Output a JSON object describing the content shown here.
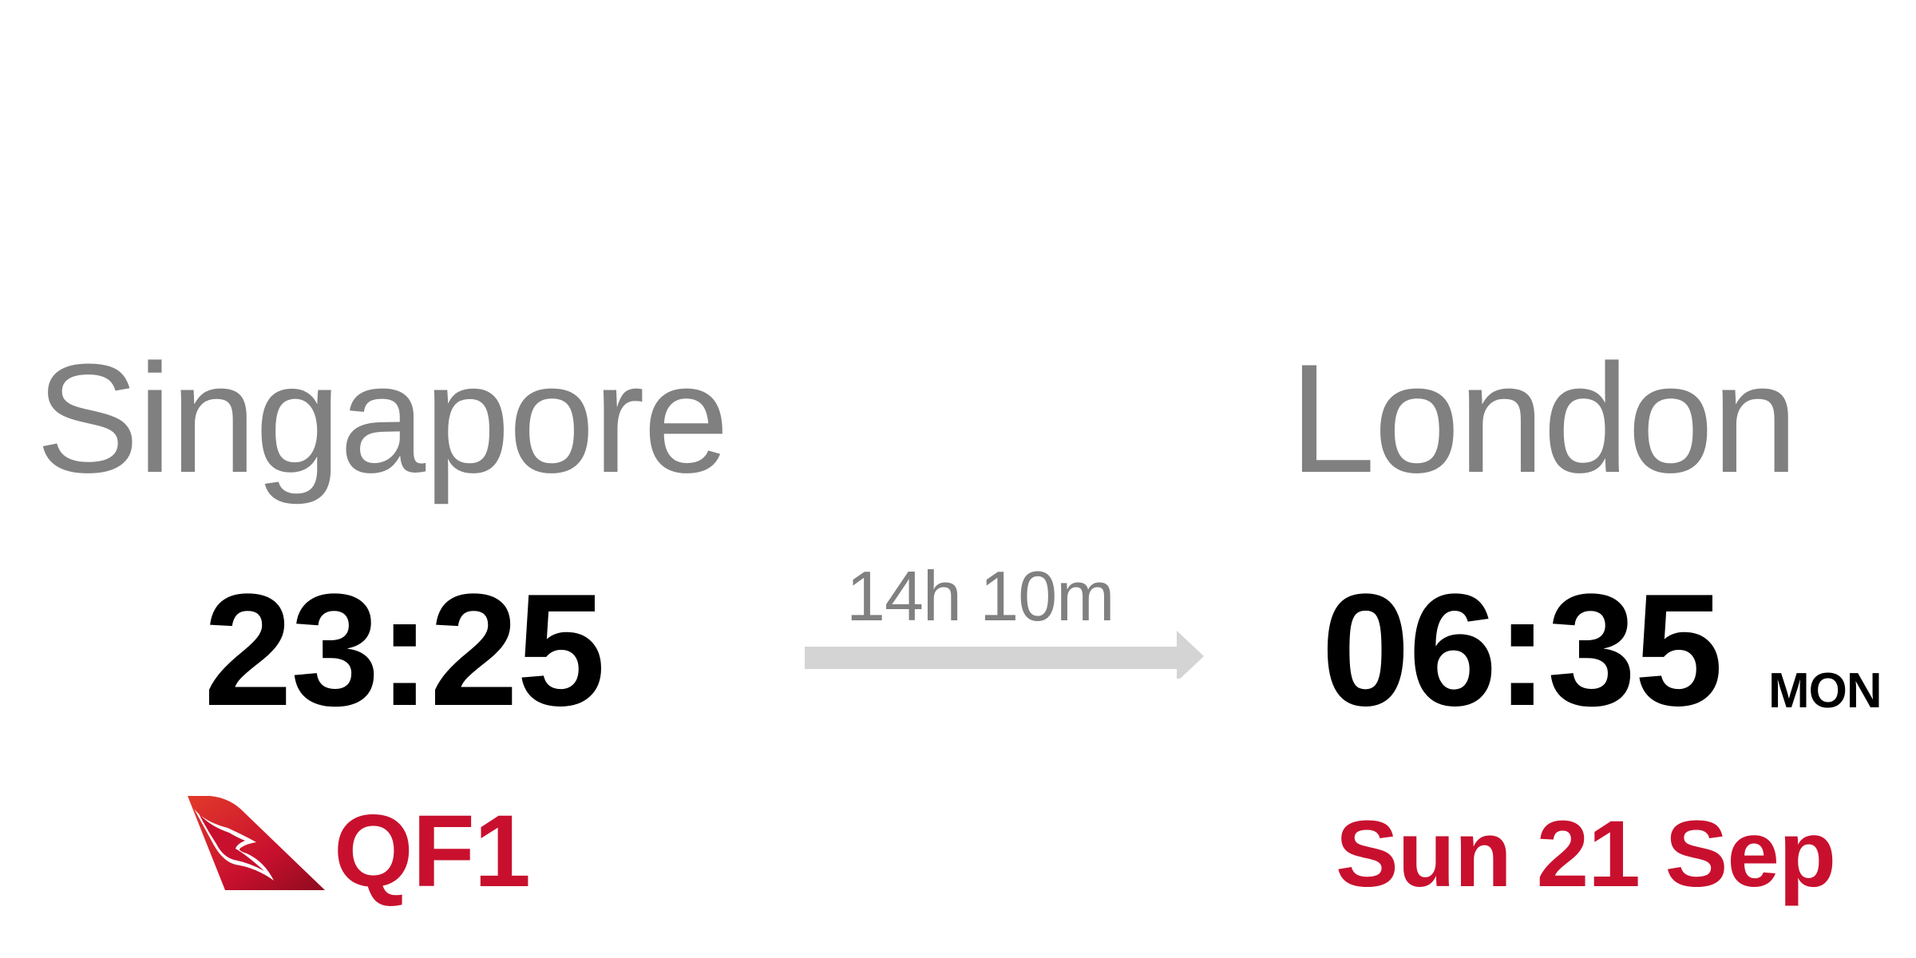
{
  "origin": {
    "city": "Singapore",
    "time": "23:25"
  },
  "destination": {
    "city": "London",
    "time": "06:35",
    "day_marker": "MON",
    "date": "Sun 21 Sep"
  },
  "flight": {
    "duration": "14h 10m",
    "number": "QF1",
    "airline_icon": "qantas-kangaroo-icon"
  },
  "colors": {
    "city": "#808080",
    "time": "#000000",
    "accent": "#c8102e",
    "arrow": "#d4d4d4"
  }
}
